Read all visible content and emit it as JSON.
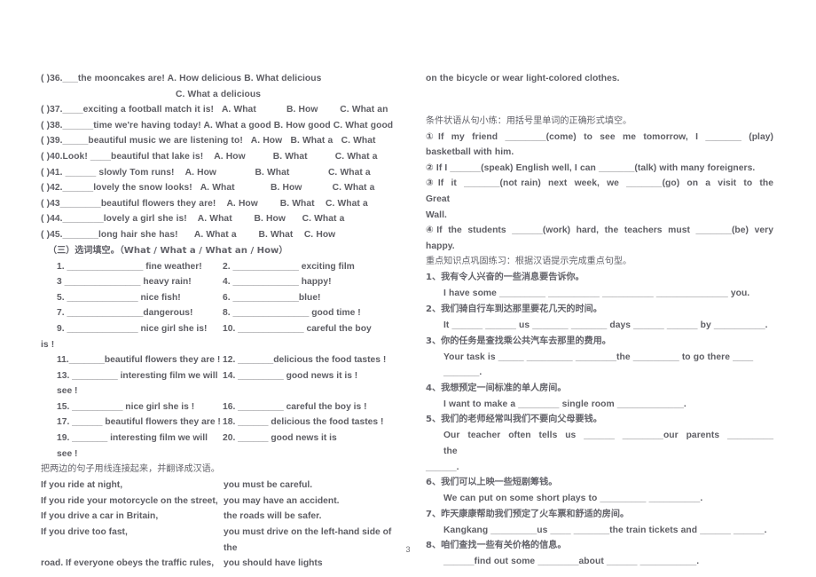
{
  "document": {
    "page_number": "3",
    "text_color": "#5e5e64",
    "background_color": "#ffffff"
  },
  "left_column": {
    "multiple_choice": [
      {
        "id": "q36",
        "stem": "( )36.___the mooncakes are! A. How delicious B. What delicious",
        "continuation": "C. What a delicious"
      },
      {
        "id": "q37",
        "stem": "( )37.____exciting a football match it is!   A. What           B. How        C. What an"
      },
      {
        "id": "q38",
        "stem": "( )38.______time we're having today! A. What a good B. How good C. What good"
      },
      {
        "id": "q39",
        "stem": "( )39._____beautiful music we are listening to!   A. How   B. What a   C. What"
      },
      {
        "id": "q40",
        "stem": "( )40.Look! ____beautiful that lake is!    A. How          B. What          C. What a"
      },
      {
        "id": "q41",
        "stem": "( )41. ______ slowly Tom runs!    A. How              B. What              C. What a"
      },
      {
        "id": "q42",
        "stem": "( )42.______lovely the snow looks!   A. What             B. How           C. What a"
      },
      {
        "id": "q43",
        "stem": "( )43________beautiful flowers they are!    A. How        B. What    C. What a"
      },
      {
        "id": "q44",
        "stem": "( )44.________lovely a girl she is!    A. What        B. How      C. What a"
      },
      {
        "id": "q45",
        "stem": "( )45._______long hair she has!      A. What a        B. What    C. How"
      }
    ],
    "section_three_heading": "（三）选词填空。（What / What a / What an / How）",
    "fill_blanks_pairs": [
      {
        "left": "1. _______________ fine weather!",
        "right": "2. _____________ exciting film"
      },
      {
        "left": "3 _______________ heavy rain!",
        "right": "4. _____________ happy!"
      },
      {
        "left": "5. ______________ nice fish!",
        "right": "6. _____________blue!"
      },
      {
        "left": "7. _______________dangerous!",
        "right": "8. _______________ good time !"
      },
      {
        "left": "9. ______________ nice girl she is!",
        "right": "10. _____________ careful the boy"
      }
    ],
    "fill_blanks_wrap": "is !",
    "fill_blanks_pairs2": [
      {
        "left": "11._______beautiful flowers they are !",
        "right": "12. _______delicious the food tastes !"
      },
      {
        "left": "13. _________ interesting film we will see !",
        "right": "14. _________ good news it is !"
      },
      {
        "left": "15. __________ nice girl she is    !",
        "right": "16. _________ careful the boy is !"
      },
      {
        "left": "17. ______ beautiful flowers they are !",
        "right": "18. ______ delicious the food tastes !"
      },
      {
        "left": "19. _______ interesting film we will see !",
        "right": "20. ______ good news it is"
      }
    ],
    "matching_heading": "把两边的句子用线连接起来，并翻译成汉语。",
    "matching_rows": [
      {
        "left": "If you ride at night,",
        "right": "you must be careful."
      },
      {
        "left": "If you ride your motorcycle on the street,",
        "right": "you may have an accident."
      },
      {
        "left": "If you drive a car in Britain,",
        "right": "the roads will be safer."
      },
      {
        "left": "If you drive too fast,",
        "right": "you must drive on the left-hand side of the"
      },
      {
        "left": "road. If everyone obeys the traffic rules,",
        "right": "you should have lights"
      }
    ]
  },
  "right_column": {
    "carryover_line": "on the bicycle or wear light-colored clothes.",
    "conditional_heading": "条件状语从句小练：用括号里单词的正确形式填空。",
    "conditional_items": [
      {
        "marker": "①",
        "line1": "If  my  friend  ________(come)  to  see  me  tomorrow,  I  _______  (play)",
        "line2": "basketball with him."
      },
      {
        "marker": "②",
        "line1": "If I ______(speak) English well, I can _______(talk) with many foreigners."
      },
      {
        "marker": "③",
        "line1": "If  it  _______(not rain)  next  week,  we  _______(go)  on  a  visit  to  the  Great",
        "line2": "Wall."
      },
      {
        "marker": "④",
        "line1": "If  the  students  ______(work)  hard,  the  teachers  must  _______(be)  very",
        "line2": "happy."
      }
    ],
    "translation_heading": "重点知识点巩固练习：根据汉语提示完成重点句型。",
    "translation_items": [
      {
        "cn": "1、我有令人兴奋的一些消息要告诉你。",
        "en": "I have some _________ __________ __________ ______________ you."
      },
      {
        "cn": "2、我们骑自行车到达那里要花几天的时间。",
        "en": "It ______ ______ us _______ _______ days ______ ______ by __________."
      },
      {
        "cn": "3、你的任务是查找乘公共汽车去那里的费用。",
        "en": "Your task is _____ _________ ________the _________ to go there ____ _______."
      },
      {
        "cn": "4、我想预定一间标准的单人房间。",
        "en": "I want to make a ________ single room _____________."
      },
      {
        "cn": "5、我们的老师经常叫我们不要向父母要钱。",
        "en": "Our  teacher  often  tells  us  ______  ________our  parents  _________  the",
        "en2": "______."
      },
      {
        "cn": "6、我们可以上映一些短剧筹钱。",
        "en": "We can put on some short plays to _________ __________."
      },
      {
        "cn": "7、昨天康康帮助我们预定了火车票和舒适的房间。",
        "en": "Kangkang _________us ____ _______the train tickets and ______ ______."
      },
      {
        "cn": "8、咱们查找一些有关价格的信息。",
        "en": "______find out some ________about ______ ___________."
      }
    ]
  }
}
